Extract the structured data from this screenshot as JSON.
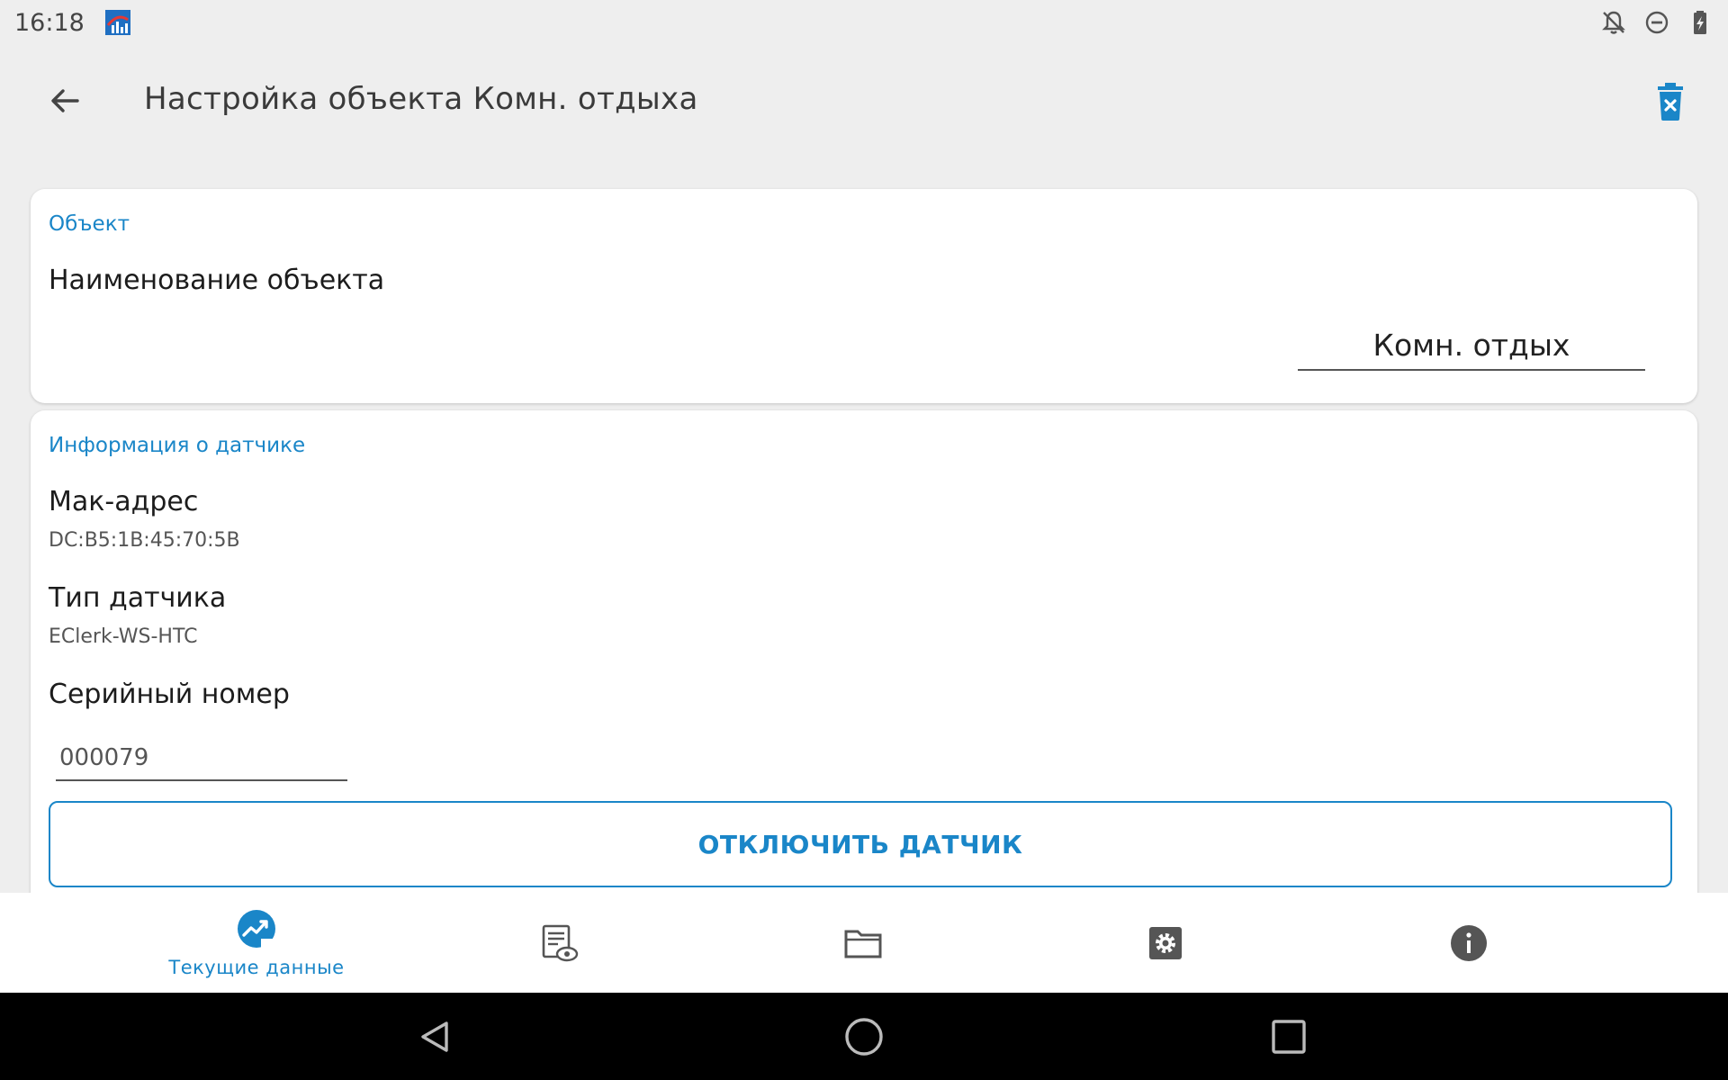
{
  "status_bar": {
    "time": "16:18"
  },
  "app_bar": {
    "title": "Настройка объекта Комн. отдыха"
  },
  "object_card": {
    "section_title": "Объект",
    "name_label": "Наименование объекта",
    "name_value": "Комн. отдых"
  },
  "sensor_card": {
    "section_title": "Информация о датчике",
    "mac_label": "Мак-адрес",
    "mac_value": "DC:B5:1B:45:70:5B",
    "type_label": "Тип датчика",
    "type_value": "EClerk-WS-HTC",
    "serial_label": "Серийный номер",
    "serial_value": "000079",
    "disconnect_label": "ОТКЛЮЧИТЬ ДАТЧИК"
  },
  "bottom_nav": {
    "items": [
      {
        "label": "Текущие данные",
        "icon": "current-data-icon",
        "active": true
      },
      {
        "label": "",
        "icon": "document-view-icon",
        "active": false
      },
      {
        "label": "",
        "icon": "folder-icon",
        "active": false
      },
      {
        "label": "",
        "icon": "settings-gear-icon",
        "active": false
      },
      {
        "label": "",
        "icon": "info-icon",
        "active": false
      }
    ]
  },
  "colors": {
    "accent": "#1a86c8",
    "background": "#eeeeee",
    "card": "#ffffff",
    "system_nav": "#000000"
  }
}
